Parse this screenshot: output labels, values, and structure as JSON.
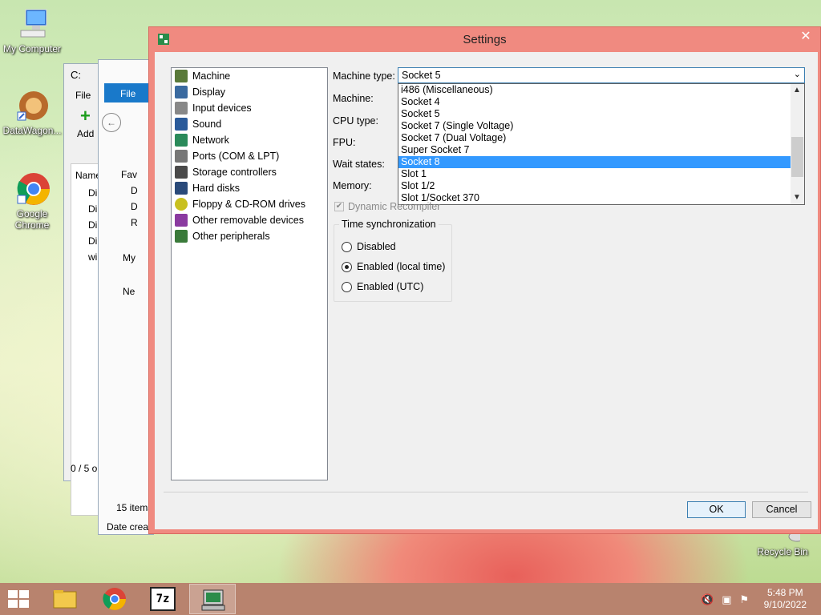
{
  "desktop": {
    "icons": [
      {
        "label": "My Computer"
      },
      {
        "label": "DataWagon..."
      },
      {
        "label": "Google Chrome"
      },
      {
        "label": "Recycle Bin"
      }
    ]
  },
  "background_explorer": {
    "title_fragment": "C:",
    "file_tab": "File",
    "file_menu": "File",
    "add_label": "Add",
    "name_header": "Name",
    "favorites_fragment": "Fav",
    "my_computer_fragment": "My",
    "network_fragment": "Ne",
    "row_fragment": "Di",
    "row_fragment_wi": "wi",
    "status_fragment": "0 / 5 o",
    "items_count": "15 items",
    "date_created_fragment": "Date creat",
    "desktop_d1": "D",
    "desktop_d2": "D",
    "desktop_r": "R"
  },
  "dialog": {
    "title": "Settings",
    "tree_items": [
      {
        "label": "Machine",
        "icon": "machine-icon"
      },
      {
        "label": "Display",
        "icon": "display-icon"
      },
      {
        "label": "Input devices",
        "icon": "input-devices-icon"
      },
      {
        "label": "Sound",
        "icon": "sound-icon"
      },
      {
        "label": "Network",
        "icon": "network-icon"
      },
      {
        "label": "Ports (COM & LPT)",
        "icon": "ports-icon"
      },
      {
        "label": "Storage controllers",
        "icon": "storage-icon"
      },
      {
        "label": "Hard disks",
        "icon": "hard-disk-icon"
      },
      {
        "label": "Floppy & CD-ROM drives",
        "icon": "floppy-cdrom-icon"
      },
      {
        "label": "Other removable devices",
        "icon": "removable-icon"
      },
      {
        "label": "Other peripherals",
        "icon": "peripherals-icon"
      }
    ],
    "labels": {
      "machine_type": "Machine type:",
      "machine": "Machine:",
      "cpu_type": "CPU type:",
      "fpu": "FPU:",
      "wait_states": "Wait states:",
      "memory": "Memory:"
    },
    "machine_type_value": "Socket 5",
    "dropdown_options": [
      "i486 (Miscellaneous)",
      "Socket 4",
      "Socket 5",
      "Socket 7 (Single Voltage)",
      "Socket 7 (Dual Voltage)",
      "Super Socket 7",
      "Socket 8",
      "Slot 1",
      "Slot 1/2",
      "Slot 1/Socket 370"
    ],
    "dropdown_selected": "Socket 8",
    "dynamic_recompiler": "Dynamic Recompiler",
    "dynamic_recompiler_checked": true,
    "time_sync": {
      "title": "Time synchronization",
      "options": [
        "Disabled",
        "Enabled (local time)",
        "Enabled (UTC)"
      ],
      "selected": "Enabled (local time)"
    },
    "ok": "OK",
    "cancel": "Cancel"
  },
  "taskbar": {
    "time": "5:48 PM",
    "date": "9/10/2022",
    "pinned": [
      "file-explorer-icon",
      "chrome-icon",
      "7zip-icon",
      "pcem-icon"
    ],
    "seven_zip_label": "7z"
  }
}
